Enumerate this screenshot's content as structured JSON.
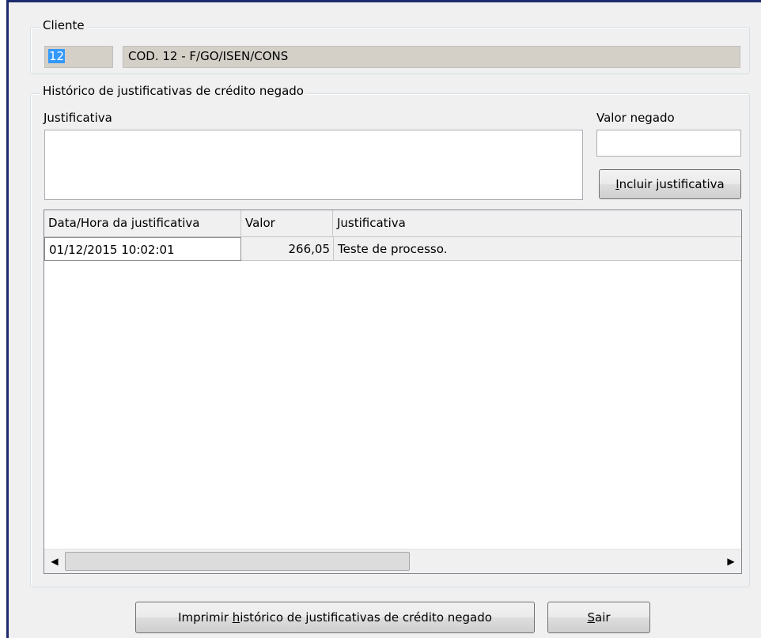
{
  "cliente": {
    "group_title": "Cliente",
    "code": "12",
    "name": "COD. 12 - F/GO/ISEN/CONS"
  },
  "historico": {
    "group_title": "Histórico de justificativas de crédito negado",
    "justificativa_label": "Justificativa",
    "justificativa_value": "",
    "valor_negado_label": "Valor negado",
    "valor_negado_value": "",
    "incluir_button": {
      "mnemonic": "I",
      "rest": "ncluir justificativa"
    },
    "table": {
      "columns": [
        "Data/Hora da justificativa",
        "Valor",
        "Justificativa"
      ],
      "rows": [
        {
          "data_hora": "01/12/2015 10:02:01",
          "valor": "266,05",
          "justificativa": "Teste de processo."
        }
      ]
    }
  },
  "footer": {
    "imprimir_button": {
      "before": "Imprimir ",
      "mnemonic": "h",
      "after": "istórico de justificativas de crédito negado"
    },
    "sair_button": {
      "mnemonic": "S",
      "rest": "air"
    }
  },
  "scrollbar": {
    "left_icon": "arrow-left",
    "right_icon": "arrow-right"
  }
}
